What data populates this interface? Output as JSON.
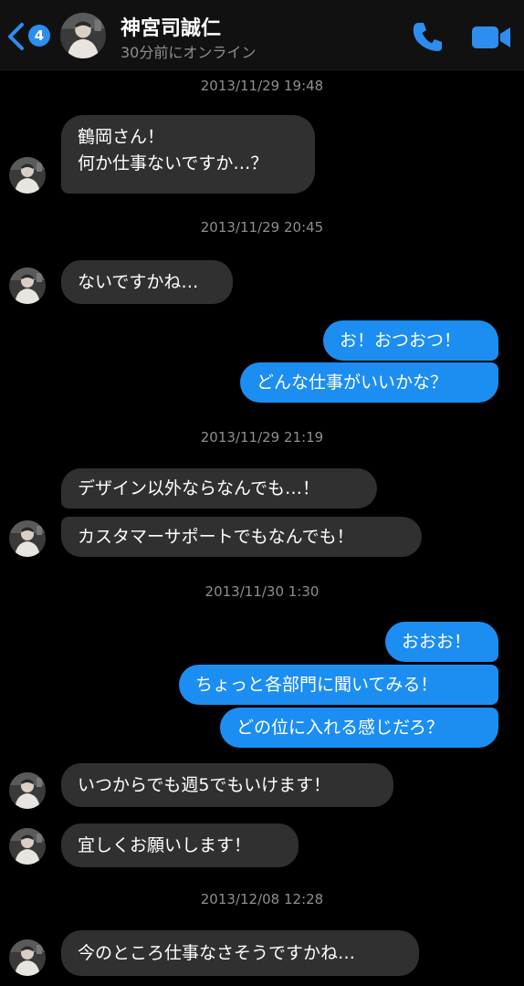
{
  "header": {
    "badge_count": "4",
    "contact_name": "神宮司誠仁",
    "status": "30分前にオンライン",
    "accent_color": "#2d8ef0"
  },
  "timestamps": [
    "2013/11/29 19:48",
    "2013/11/29 20:45",
    "2013/11/29 21:19",
    "2013/11/30 1:30",
    "2013/12/08 12:28"
  ],
  "messages": [
    {
      "side": "incoming",
      "text_line1": "鶴岡さん！",
      "text_line2": "何か仕事ないですか…？"
    },
    {
      "side": "incoming",
      "text": "ないですかね…"
    },
    {
      "side": "outgoing",
      "text": "お！おつおつ！"
    },
    {
      "side": "outgoing",
      "text": "どんな仕事がいいかな？"
    },
    {
      "side": "incoming",
      "text": "デザイン以外ならなんでも…！"
    },
    {
      "side": "incoming",
      "text": "カスタマーサポートでもなんでも！"
    },
    {
      "side": "outgoing",
      "text": "おおお！"
    },
    {
      "side": "outgoing",
      "text": "ちょっと各部門に聞いてみる！"
    },
    {
      "side": "outgoing",
      "text": "どの位に入れる感じだろ？"
    },
    {
      "side": "incoming",
      "text": "いつからでも週5でもいけます！"
    },
    {
      "side": "incoming",
      "text": "宜しくお願いします！"
    },
    {
      "side": "incoming",
      "text": "今のところ仕事なさそうですかね…"
    }
  ],
  "icons": {
    "back": "chevron-left-icon",
    "call": "phone-icon",
    "video": "video-camera-icon"
  },
  "colors": {
    "incoming_bubble": "#303030",
    "outgoing_bubble": "#1c8ef2",
    "background": "#000000",
    "timestamp": "#8e8e93"
  }
}
